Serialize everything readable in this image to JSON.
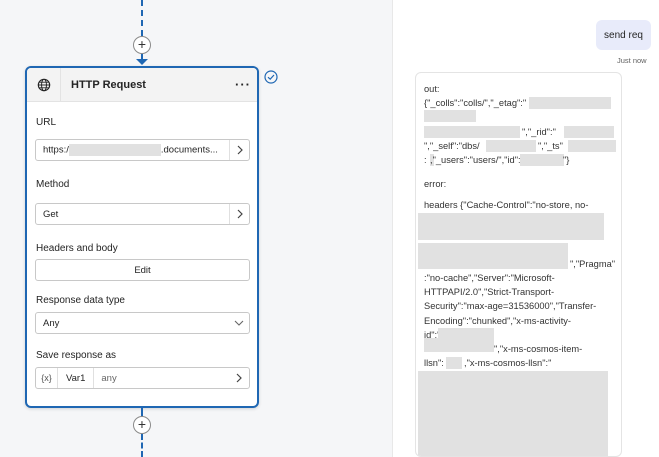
{
  "node": {
    "title": "HTTP Request",
    "more_label": "···",
    "url_label": "URL",
    "url_prefix": "https:/",
    "url_suffix": ".documents...",
    "method_label": "Method",
    "method_value": "Get",
    "headers_label": "Headers and body",
    "edit_label": "Edit",
    "response_type_label": "Response data type",
    "response_type_value": "Any",
    "save_label": "Save response as",
    "var_badge": "{x}",
    "var_name": "Var1",
    "var_type": "any"
  },
  "canvas": {
    "plus_top": "+",
    "plus_bottom": "+"
  },
  "chat": {
    "user_message": "send req",
    "timestamp": "Just now",
    "response": {
      "out_label": "out:",
      "line1": "{\"_colls\":\"colls/\",\"_etag\":\"",
      "line3": "\",\"_rid\":\"",
      "line4a": "\",\"_self\":\"dbs/",
      "line4b": "\",\"_ts\"",
      "line5a": ":",
      "line5b": ",\"_users\":\"users/\",\"id\":\"",
      "line5c": "\"}",
      "error_label": "error:",
      "headers_line": "headers {\"Cache-Control\":\"no-store, no-",
      "pragma": "\",\"Pragma\"",
      "h1": ":\"no-cache\",\"Server\":\"Microsoft-",
      "h2": "HTTPAPI/2.0\",\"Strict-Transport-",
      "h3": "Security\":\"max-age=31536000\",\"Transfer-",
      "h4": "Encoding\":\"chunked\",\"x-ms-activity-",
      "h5": "id\":\"",
      "h6": "\",\"x-ms-cosmos-item-",
      "h7a": "llsn\":",
      "h7b": ",\"x-ms-cosmos-llsn\":\""
    }
  }
}
